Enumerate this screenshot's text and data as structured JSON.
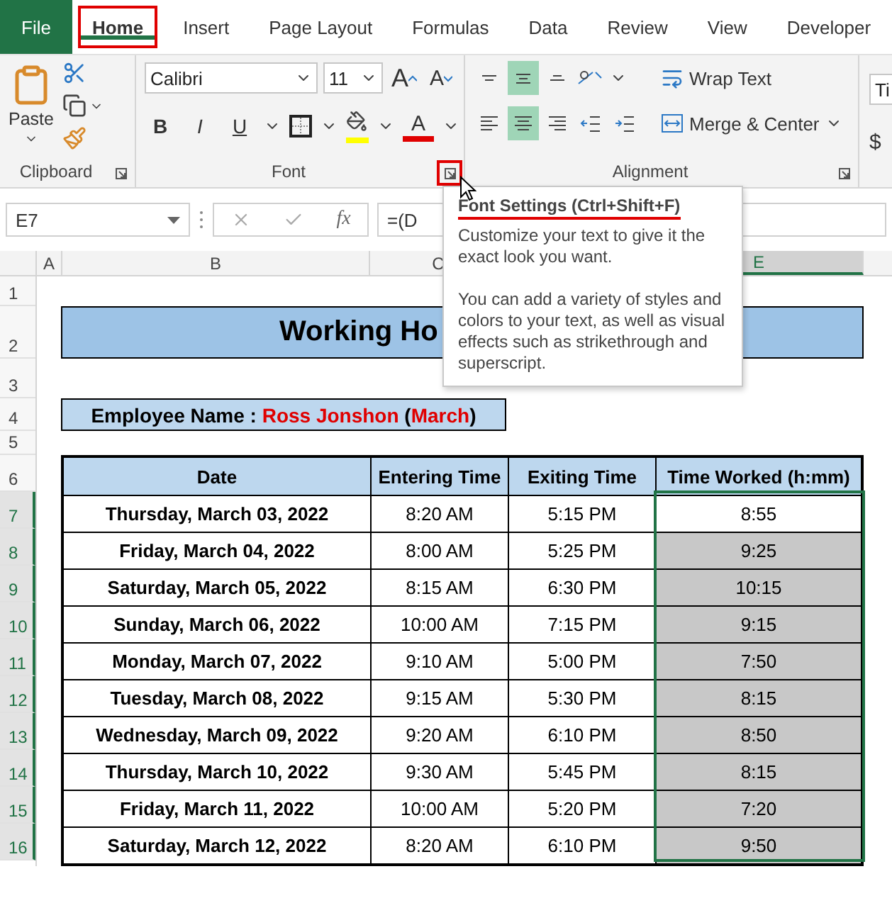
{
  "tabs": [
    {
      "label": "File",
      "kind": "file",
      "selected": false,
      "highlighted": false
    },
    {
      "label": "Home",
      "kind": "tab",
      "selected": true,
      "highlighted": true
    },
    {
      "label": "Insert",
      "kind": "tab",
      "selected": false,
      "highlighted": false
    },
    {
      "label": "Page Layout",
      "kind": "tab",
      "selected": false,
      "highlighted": false
    },
    {
      "label": "Formulas",
      "kind": "tab",
      "selected": false,
      "highlighted": false
    },
    {
      "label": "Data",
      "kind": "tab",
      "selected": false,
      "highlighted": false
    },
    {
      "label": "Review",
      "kind": "tab",
      "selected": false,
      "highlighted": false
    },
    {
      "label": "View",
      "kind": "tab",
      "selected": false,
      "highlighted": false
    },
    {
      "label": "Developer",
      "kind": "tab",
      "selected": false,
      "highlighted": false
    }
  ],
  "ribbon": {
    "clipboard": {
      "paste_label": "Paste",
      "group_label": "Clipboard"
    },
    "font": {
      "font_name": "Calibri",
      "font_size": "11",
      "size_buttons": [
        {
          "label": "A",
          "kind": "grow"
        },
        {
          "label": "A",
          "kind": "shrink"
        }
      ],
      "style_buttons": [
        {
          "label": "B",
          "kind": "bold"
        },
        {
          "label": "I",
          "kind": "italic"
        },
        {
          "label": "U",
          "kind": "underline"
        }
      ],
      "font_color_label": "A",
      "group_label": "Font",
      "launcher_highlighted": true
    },
    "alignment": {
      "buttons": [
        {
          "kind": "top",
          "selected": false
        },
        {
          "kind": "middle",
          "selected": true
        },
        {
          "kind": "bottom",
          "selected": false
        },
        {
          "kind": "left",
          "selected": false
        },
        {
          "kind": "center",
          "selected": true
        },
        {
          "kind": "right",
          "selected": false
        },
        {
          "kind": "outdent",
          "selected": false
        },
        {
          "kind": "indent",
          "selected": false
        }
      ],
      "wrap_text": "Wrap Text",
      "merge_center": "Merge & Center",
      "group_label": "Alignment"
    },
    "number": {
      "format_value": "Ti",
      "currency_label": "$"
    }
  },
  "formula_bar": {
    "name_box": "E7",
    "fx": "fx",
    "formula": "=(D"
  },
  "tooltip": {
    "title": "Font Settings (Ctrl+Shift+F)",
    "title_underlined": true,
    "paragraphs": [
      "Customize your text to give it the exact look you want.",
      "You can add a variety of styles and colors to your text, as well as visual effects such as strikethrough and superscript."
    ]
  },
  "column_headers": [
    {
      "label": "A",
      "selected": false
    },
    {
      "label": "B",
      "selected": false
    },
    {
      "label": "C",
      "selected": false
    },
    {
      "label": "E",
      "selected": true
    }
  ],
  "row_headers": [
    {
      "label": "1",
      "selected": false
    },
    {
      "label": "2",
      "selected": false
    },
    {
      "label": "3",
      "selected": false
    },
    {
      "label": "4",
      "selected": false
    },
    {
      "label": "5",
      "selected": false
    },
    {
      "label": "6",
      "selected": false
    },
    {
      "label": "7",
      "selected": true
    },
    {
      "label": "8",
      "selected": true
    },
    {
      "label": "9",
      "selected": true
    },
    {
      "label": "10",
      "selected": true
    },
    {
      "label": "11",
      "selected": true
    },
    {
      "label": "12",
      "selected": true
    },
    {
      "label": "13",
      "selected": true
    },
    {
      "label": "14",
      "selected": true
    },
    {
      "label": "15",
      "selected": true
    },
    {
      "label": "16",
      "selected": true
    }
  ],
  "sheet": {
    "title": "Working Ho",
    "employee": [
      {
        "text": "Employee Name : ",
        "highlight": false
      },
      {
        "text": "Ross Jonshon",
        "highlight": true
      },
      {
        "text": " (",
        "highlight": false
      },
      {
        "text": "March",
        "highlight": true
      },
      {
        "text": ")",
        "highlight": false
      }
    ],
    "table": {
      "columns": [
        "Date",
        "Entering Time",
        "Exiting Time",
        "Time Worked (h:mm)"
      ],
      "rows": [
        {
          "date": "Thursday, March 03, 2022",
          "entering": "8:20 AM",
          "exiting": "5:15 PM",
          "worked": "8:55",
          "highlighted": false
        },
        {
          "date": "Friday, March 04, 2022",
          "entering": "8:00 AM",
          "exiting": "5:25 PM",
          "worked": "9:25",
          "highlighted": true
        },
        {
          "date": "Saturday, March 05, 2022",
          "entering": "8:15 AM",
          "exiting": "6:30 PM",
          "worked": "10:15",
          "highlighted": true
        },
        {
          "date": "Sunday, March 06, 2022",
          "entering": "10:00 AM",
          "exiting": "7:15 PM",
          "worked": "9:15",
          "highlighted": true
        },
        {
          "date": "Monday, March 07, 2022",
          "entering": "9:10 AM",
          "exiting": "5:00 PM",
          "worked": "7:50",
          "highlighted": true
        },
        {
          "date": "Tuesday, March 08, 2022",
          "entering": "9:15 AM",
          "exiting": "5:30 PM",
          "worked": "8:15",
          "highlighted": true
        },
        {
          "date": "Wednesday, March 09, 2022",
          "entering": "9:20 AM",
          "exiting": "6:10 PM",
          "worked": "8:50",
          "highlighted": true
        },
        {
          "date": "Thursday, March 10, 2022",
          "entering": "9:30 AM",
          "exiting": "5:45 PM",
          "worked": "8:15",
          "highlighted": true
        },
        {
          "date": "Friday, March 11, 2022",
          "entering": "10:00 AM",
          "exiting": "5:20 PM",
          "worked": "7:20",
          "highlighted": true
        },
        {
          "date": "Saturday, March 12, 2022",
          "entering": "8:20 AM",
          "exiting": "6:10 PM",
          "worked": "9:50",
          "highlighted": true
        }
      ]
    }
  }
}
